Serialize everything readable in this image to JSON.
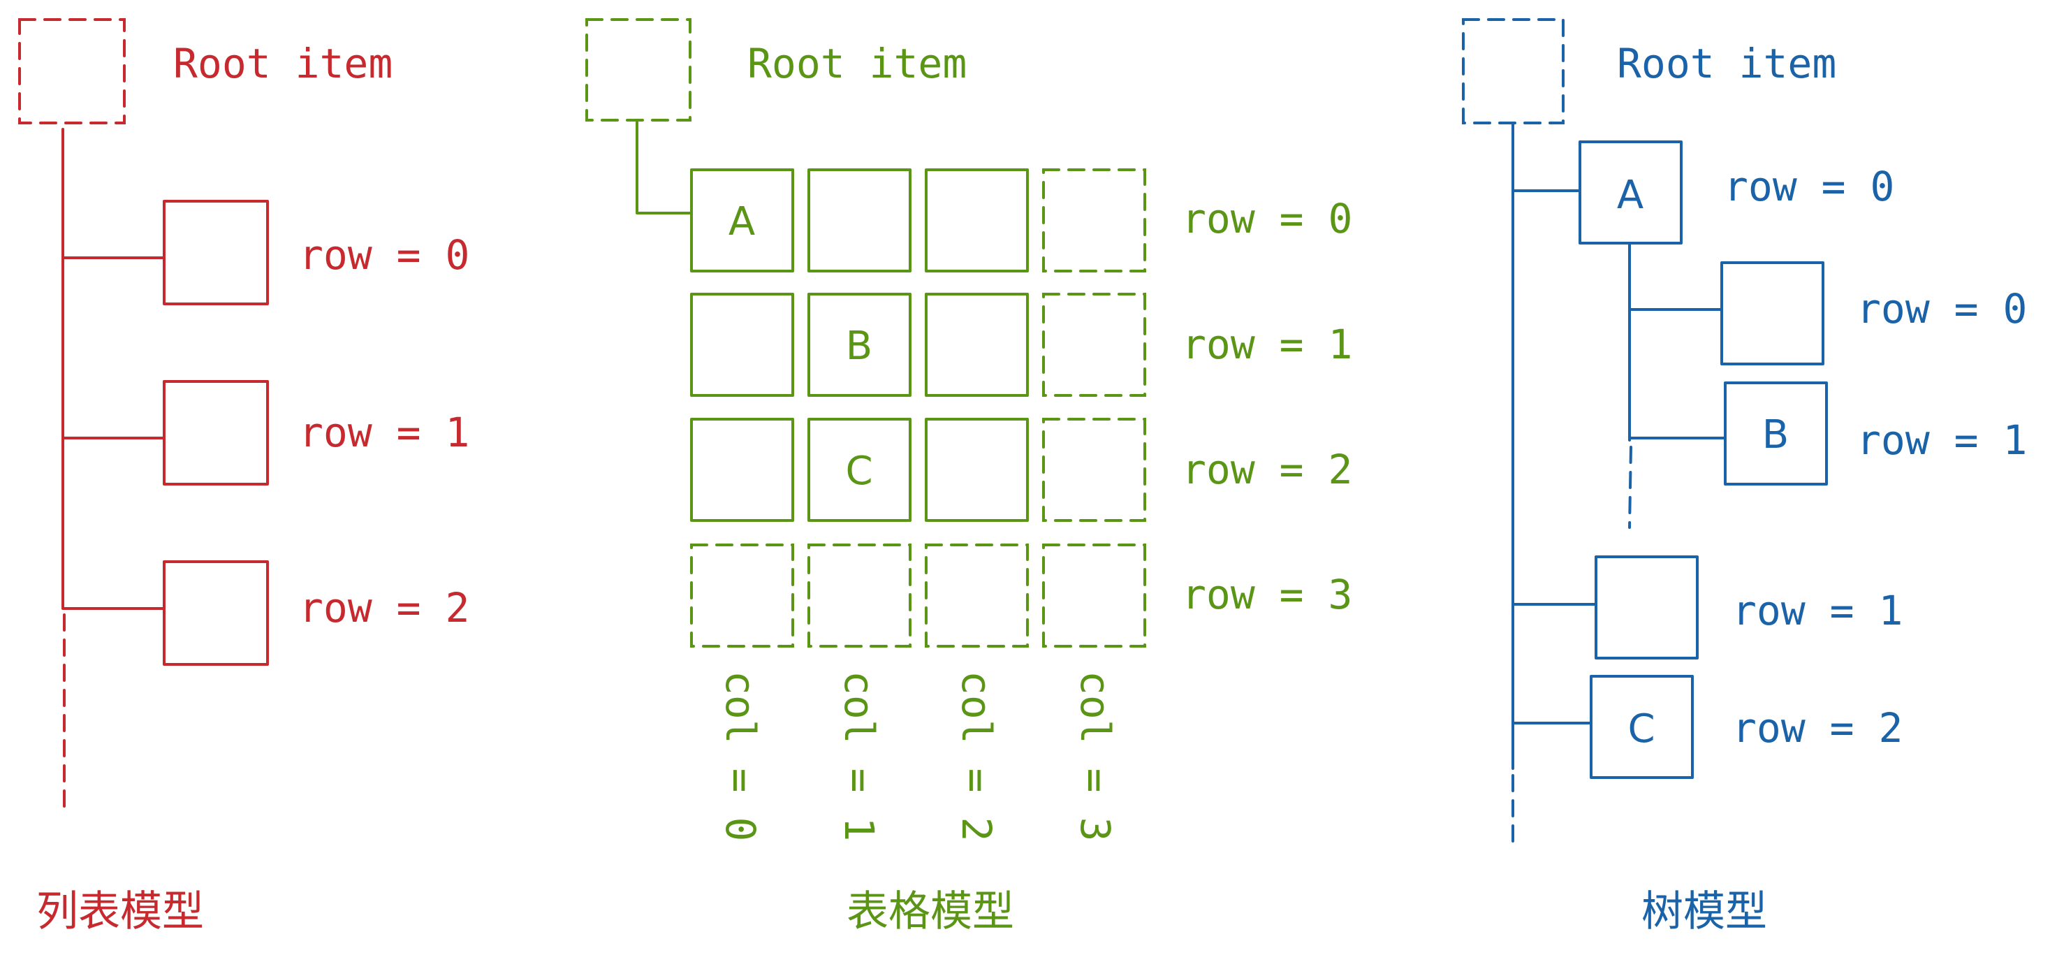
{
  "colors": {
    "list": "#c62a2f",
    "table": "#5b9516",
    "tree": "#1b63a8"
  },
  "list_model": {
    "root_label": "Root item",
    "rows": [
      "row = 0",
      "row = 1",
      "row = 2"
    ],
    "caption": "列表模型"
  },
  "table_model": {
    "root_label": "Root item",
    "rows": [
      "row = 0",
      "row = 1",
      "row = 2",
      "row = 3"
    ],
    "cols": [
      "col = 0",
      "col = 1",
      "col = 2",
      "col = 3"
    ],
    "cells": {
      "a": "A",
      "b": "B",
      "c": "C"
    },
    "caption": "表格模型"
  },
  "tree_model": {
    "root_label": "Root item",
    "node_a": "A",
    "node_b": "B",
    "node_c": "C",
    "rows": {
      "a": "row = 0",
      "a_child0": "row = 0",
      "a_child1": "row = 1",
      "top1": "row = 1",
      "top2": "row = 2"
    },
    "caption": "树模型"
  }
}
